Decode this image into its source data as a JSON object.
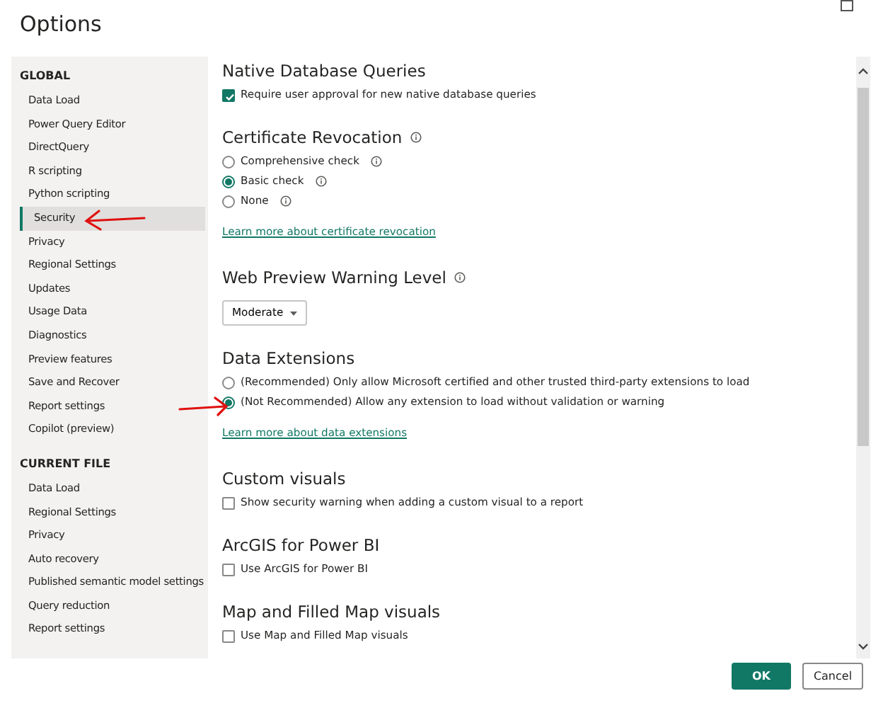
{
  "window": {
    "title": "Options"
  },
  "sidebar": {
    "sections": [
      {
        "heading": "GLOBAL",
        "items": [
          {
            "label": "Data Load",
            "selected": false
          },
          {
            "label": "Power Query Editor",
            "selected": false
          },
          {
            "label": "DirectQuery",
            "selected": false
          },
          {
            "label": "R scripting",
            "selected": false
          },
          {
            "label": "Python scripting",
            "selected": false
          },
          {
            "label": "Security",
            "selected": true
          },
          {
            "label": "Privacy",
            "selected": false
          },
          {
            "label": "Regional Settings",
            "selected": false
          },
          {
            "label": "Updates",
            "selected": false
          },
          {
            "label": "Usage Data",
            "selected": false
          },
          {
            "label": "Diagnostics",
            "selected": false
          },
          {
            "label": "Preview features",
            "selected": false
          },
          {
            "label": "Save and Recover",
            "selected": false
          },
          {
            "label": "Report settings",
            "selected": false
          },
          {
            "label": "Copilot (preview)",
            "selected": false
          }
        ]
      },
      {
        "heading": "CURRENT FILE",
        "items": [
          {
            "label": "Data Load",
            "selected": false
          },
          {
            "label": "Regional Settings",
            "selected": false
          },
          {
            "label": "Privacy",
            "selected": false
          },
          {
            "label": "Auto recovery",
            "selected": false
          },
          {
            "label": "Published semantic model settings",
            "selected": false
          },
          {
            "label": "Query reduction",
            "selected": false
          },
          {
            "label": "Report settings",
            "selected": false
          }
        ]
      }
    ]
  },
  "sections": [
    {
      "heading": "Native Database Queries",
      "info": false,
      "controls": [
        {
          "kind": "checkbox",
          "label": "Require user approval for new native database queries",
          "checked": true
        }
      ]
    },
    {
      "heading": "Certificate Revocation",
      "info": true,
      "controls": [
        {
          "kind": "radio",
          "label": "Comprehensive check",
          "checked": false,
          "info": true
        },
        {
          "kind": "radio",
          "label": "Basic check",
          "checked": true,
          "info": true
        },
        {
          "kind": "radio",
          "label": "None",
          "checked": false,
          "info": true
        },
        {
          "kind": "link",
          "label": "Learn more about certificate revocation"
        }
      ]
    },
    {
      "heading": "Web Preview Warning Level",
      "info": true,
      "controls": [
        {
          "kind": "dropdown",
          "label": "Moderate"
        }
      ]
    },
    {
      "heading": "Data Extensions",
      "info": false,
      "controls": [
        {
          "kind": "radio",
          "label": "(Recommended) Only allow Microsoft certified and other trusted third-party extensions to load",
          "checked": false,
          "info": false
        },
        {
          "kind": "radio",
          "label": "(Not Recommended) Allow any extension to load without validation or warning",
          "checked": true,
          "info": false
        },
        {
          "kind": "link",
          "label": "Learn more about data extensions"
        }
      ]
    },
    {
      "heading": "Custom visuals",
      "info": false,
      "controls": [
        {
          "kind": "checkbox",
          "label": "Show security warning when adding a custom visual to a report",
          "checked": false
        }
      ]
    },
    {
      "heading": "ArcGIS for Power BI",
      "info": false,
      "controls": [
        {
          "kind": "checkbox",
          "label": "Use ArcGIS for Power BI",
          "checked": false
        }
      ]
    },
    {
      "heading": "Map and Filled Map visuals",
      "info": false,
      "controls": [
        {
          "kind": "checkbox",
          "label": "Use Map and Filled Map visuals",
          "checked": false
        }
      ]
    }
  ],
  "buttons": [
    {
      "label": "OK",
      "primary": true
    },
    {
      "label": "Cancel",
      "primary": false
    }
  ]
}
